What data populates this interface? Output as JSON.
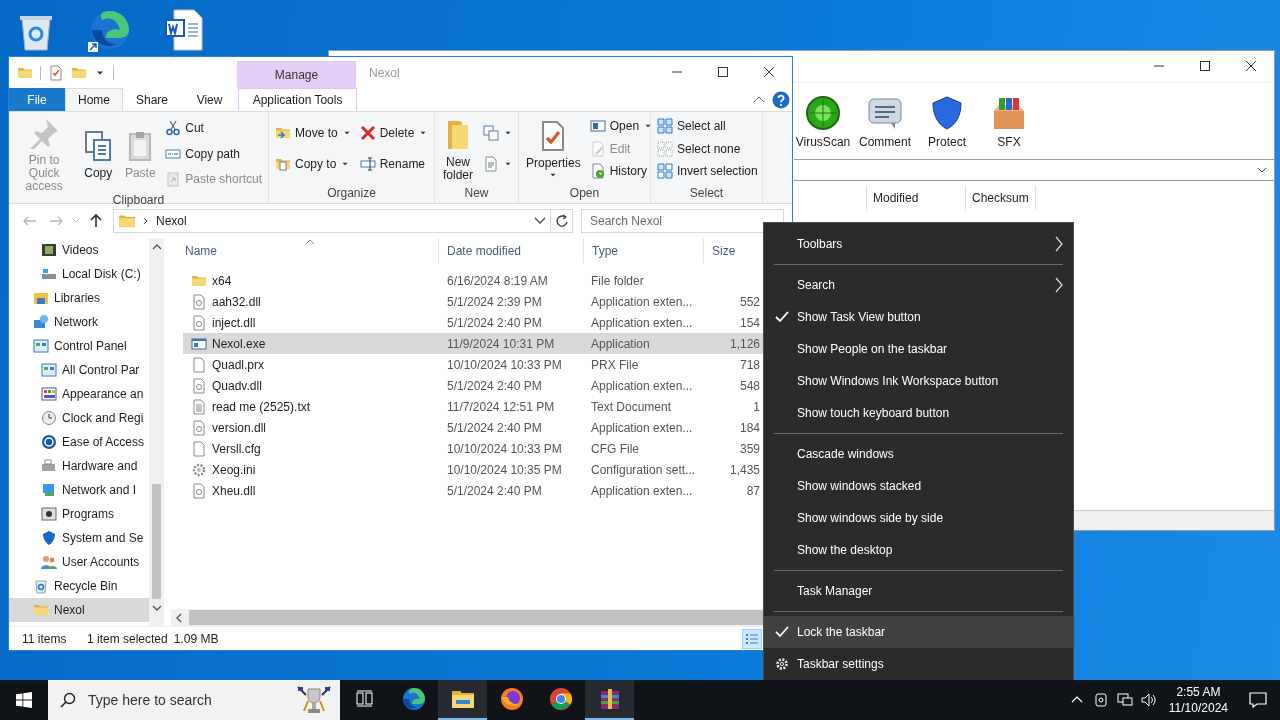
{
  "background_window": {
    "toolbar": [
      {
        "label": "VirusScan",
        "kind": "virus"
      },
      {
        "label": "Comment",
        "kind": "comment"
      },
      {
        "label": "Protect",
        "kind": "shield"
      },
      {
        "label": "SFX",
        "kind": "box"
      }
    ],
    "columns": [
      "Modified",
      "Checksum"
    ]
  },
  "explorer": {
    "title": "Nexol",
    "context_tab": "Manage",
    "tabs": [
      {
        "label": "File",
        "kind": "file",
        "selected": false
      },
      {
        "label": "Home",
        "kind": "tab",
        "selected": true
      },
      {
        "label": "Share",
        "kind": "tab",
        "selected": false
      },
      {
        "label": "View",
        "kind": "tab",
        "selected": false
      },
      {
        "label": "Application Tools",
        "kind": "context",
        "selected": false
      }
    ],
    "ribbon": [
      {
        "name": "Clipboard",
        "columns": [
          [
            {
              "label": "Pin to Quick access",
              "kind": "large",
              "disabled": true,
              "dropdown": false
            }
          ],
          [
            {
              "label": "Copy",
              "kind": "large",
              "disabled": false,
              "dropdown": false
            }
          ],
          [
            {
              "label": "Paste",
              "kind": "large",
              "disabled": true,
              "dropdown": false
            }
          ],
          [
            {
              "label": "Cut",
              "kind": "small",
              "disabled": false,
              "dropdown": false
            },
            {
              "label": "Copy path",
              "kind": "small",
              "disabled": false,
              "dropdown": false
            },
            {
              "label": "Paste shortcut",
              "kind": "small",
              "disabled": true,
              "dropdown": false
            }
          ]
        ]
      },
      {
        "name": "Organize",
        "columns": [
          [
            {
              "label": "Move to",
              "kind": "small",
              "disabled": false,
              "dropdown": true
            },
            {
              "label": "Copy to",
              "kind": "small",
              "disabled": false,
              "dropdown": true
            }
          ],
          [
            {
              "label": "Delete",
              "kind": "small",
              "disabled": false,
              "dropdown": true
            },
            {
              "label": "Rename",
              "kind": "small",
              "disabled": false,
              "dropdown": false
            }
          ]
        ]
      },
      {
        "name": "New",
        "columns": [
          [
            {
              "label": "New folder",
              "kind": "large",
              "disabled": false,
              "dropdown": false
            }
          ],
          [
            {
              "kind": "small",
              "disabled": false,
              "dropdown": true
            },
            {
              "kind": "small",
              "disabled": false,
              "dropdown": true
            }
          ]
        ]
      },
      {
        "name": "Open",
        "columns": [
          [
            {
              "label": "Properties",
              "kind": "large",
              "disabled": false,
              "dropdown": true
            }
          ],
          [
            {
              "label": "Open",
              "kind": "small",
              "disabled": false,
              "dropdown": true
            },
            {
              "label": "Edit",
              "kind": "small",
              "disabled": true,
              "dropdown": false
            },
            {
              "label": "History",
              "kind": "small",
              "disabled": false,
              "dropdown": false
            }
          ]
        ]
      },
      {
        "name": "Select",
        "columns": [
          [
            {
              "label": "Select all",
              "kind": "small",
              "disabled": false,
              "dropdown": false
            },
            {
              "label": "Select none",
              "kind": "small",
              "disabled": false,
              "dropdown": false
            },
            {
              "label": "Invert selection",
              "kind": "small",
              "disabled": false,
              "dropdown": false
            }
          ]
        ]
      }
    ],
    "address": "Nexol",
    "search": {
      "placeholder": "Search Nexol"
    },
    "nav": [
      {
        "children": [
          {
            "label": "Videos",
            "kind": "videos",
            "selected": false
          },
          {
            "label": "Local Disk (C:)",
            "kind": "disk",
            "selected": false
          }
        ]
      },
      {
        "label": "Libraries",
        "kind": "libraries",
        "selected": false
      },
      {
        "label": "Network",
        "kind": "network",
        "selected": false
      },
      {
        "label": "Control Panel",
        "kind": "controlpanel",
        "selected": false,
        "children": [
          {
            "label": "All Control Par",
            "kind": "controlpanel",
            "selected": false
          },
          {
            "label": "Appearance an",
            "kind": "appearance",
            "selected": false
          },
          {
            "label": "Clock and Regi",
            "kind": "clock",
            "selected": false
          },
          {
            "label": "Ease of Access",
            "kind": "access",
            "selected": false
          },
          {
            "label": "Hardware and",
            "kind": "hardware",
            "selected": false
          },
          {
            "label": "Network and I",
            "kind": "netint",
            "selected": false
          },
          {
            "label": "Programs",
            "kind": "programs",
            "selected": false
          },
          {
            "label": "System and Se",
            "kind": "security",
            "selected": false
          },
          {
            "label": "User Accounts",
            "kind": "users",
            "selected": false
          }
        ]
      },
      {
        "label": "Recycle Bin",
        "kind": "recycle",
        "selected": false
      },
      {
        "label": "Nexol",
        "kind": "folder",
        "selected": true
      }
    ],
    "columns": [
      "Name",
      "Date modified",
      "Type",
      "Size"
    ],
    "files": [
      {
        "name": "x64",
        "date": "6/16/2024 8:19 AM",
        "type": "File folder",
        "kind": "folder",
        "selected": false
      },
      {
        "name": "aah32.dll",
        "date": "5/1/2024 2:39 PM",
        "type": "Application exten...",
        "size": "552",
        "kind": "dll",
        "selected": false
      },
      {
        "name": "inject.dll",
        "date": "5/1/2024 2:40 PM",
        "type": "Application exten...",
        "size": "154",
        "kind": "dll",
        "selected": false
      },
      {
        "name": "Nexol.exe",
        "date": "11/9/2024 10:31 PM",
        "type": "Application",
        "size": "1,126",
        "kind": "exe",
        "selected": true
      },
      {
        "name": "Quadl.prx",
        "date": "10/10/2024 10:33 PM",
        "type": "PRX File",
        "size": "718",
        "kind": "blank",
        "selected": false
      },
      {
        "name": "Quadv.dll",
        "date": "5/1/2024 2:40 PM",
        "type": "Application exten...",
        "size": "548",
        "kind": "dll",
        "selected": false
      },
      {
        "name": "read me (2525).txt",
        "date": "11/7/2024 12:51 PM",
        "type": "Text Document",
        "size": "1",
        "kind": "text",
        "selected": false
      },
      {
        "name": "version.dll",
        "date": "5/1/2024 2:40 PM",
        "type": "Application exten...",
        "size": "184",
        "kind": "dll",
        "selected": false
      },
      {
        "name": "Versll.cfg",
        "date": "10/10/2024 10:33 PM",
        "type": "CFG File",
        "size": "359",
        "kind": "blank",
        "selected": false
      },
      {
        "name": "Xeog.ini",
        "date": "10/10/2024 10:35 PM",
        "type": "Configuration sett...",
        "size": "1,435",
        "kind": "settings",
        "selected": false
      },
      {
        "name": "Xheu.dll",
        "date": "5/1/2024 2:40 PM",
        "type": "Application exten...",
        "size": "87",
        "kind": "dll",
        "selected": false
      }
    ],
    "status": {
      "count": "11 items",
      "selection": "1 item selected",
      "size": "1.09 MB"
    }
  },
  "context_menu": [
    {
      "label": "Toolbars",
      "kind": "submenu",
      "checked": false,
      "selected": false
    },
    {
      "kind": "separator"
    },
    {
      "label": "Search",
      "kind": "submenu",
      "checked": false,
      "selected": false
    },
    {
      "label": "Show Task View button",
      "kind": "item",
      "checked": true,
      "selected": false
    },
    {
      "label": "Show People on the taskbar",
      "kind": "item",
      "checked": false,
      "selected": false
    },
    {
      "label": "Show Windows Ink Workspace button",
      "kind": "item",
      "checked": false,
      "selected": false
    },
    {
      "label": "Show touch keyboard button",
      "kind": "item",
      "checked": false,
      "selected": false
    },
    {
      "kind": "separator"
    },
    {
      "label": "Cascade windows",
      "kind": "item",
      "checked": false,
      "selected": false
    },
    {
      "label": "Show windows stacked",
      "kind": "item",
      "checked": false,
      "selected": false
    },
    {
      "label": "Show windows side by side",
      "kind": "item",
      "checked": false,
      "selected": false
    },
    {
      "label": "Show the desktop",
      "kind": "item",
      "checked": false,
      "selected": false
    },
    {
      "kind": "separator"
    },
    {
      "label": "Task Manager",
      "kind": "item",
      "checked": false,
      "selected": false
    },
    {
      "kind": "separator"
    },
    {
      "label": "Lock the taskbar",
      "kind": "item",
      "checked": true,
      "selected": true
    },
    {
      "label": "Taskbar settings",
      "kind": "settings",
      "checked": false,
      "selected": false
    }
  ],
  "taskbar": {
    "search": {
      "placeholder": "Type here to search"
    },
    "apps": [
      {
        "kind": "taskview",
        "running": false
      },
      {
        "kind": "edge",
        "running": false
      },
      {
        "kind": "explorer",
        "running": true
      },
      {
        "kind": "firefox",
        "running": false
      },
      {
        "kind": "chrome",
        "running": false
      },
      {
        "kind": "winrar",
        "running": true
      }
    ],
    "time": "2:55 AM",
    "date": "11/10/2024"
  }
}
